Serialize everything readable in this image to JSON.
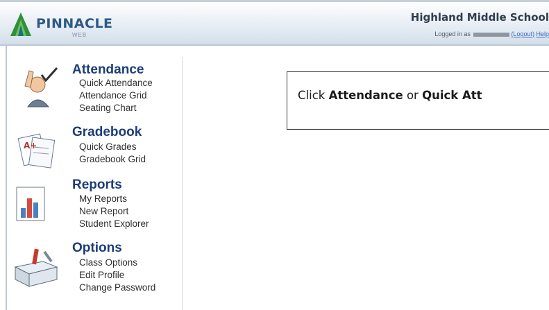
{
  "header": {
    "logo_text": "PINNACLE",
    "logo_subtext": "WEB",
    "school_name": "Highland Middle School",
    "login_prefix": "Logged in as",
    "logout_label": "(Logout)",
    "help_label": "Help"
  },
  "menu": {
    "attendance": {
      "title": "Attendance",
      "icon": "attendance-check-icon",
      "items": [
        "Quick Attendance",
        "Attendance Grid",
        "Seating Chart"
      ]
    },
    "gradebook": {
      "title": "Gradebook",
      "icon": "gradebook-papers-icon",
      "items": [
        "Quick Grades",
        "Gradebook Grid"
      ]
    },
    "reports": {
      "title": "Reports",
      "icon": "reports-bar-chart-icon",
      "items": [
        "My Reports",
        "New Report",
        "Student Explorer"
      ]
    },
    "options": {
      "title": "Options",
      "icon": "options-toolbox-icon",
      "items": [
        "Class Options",
        "Edit Profile",
        "Change Password"
      ]
    }
  },
  "callout": {
    "prefix": "Click ",
    "bold1": "Attendance",
    "middle": " or ",
    "bold2": "Quick Att"
  },
  "colors": {
    "menu_title": "#1c3d78",
    "header_gradient_bottom": "#d3dfea",
    "link": "#3a6cc0"
  }
}
